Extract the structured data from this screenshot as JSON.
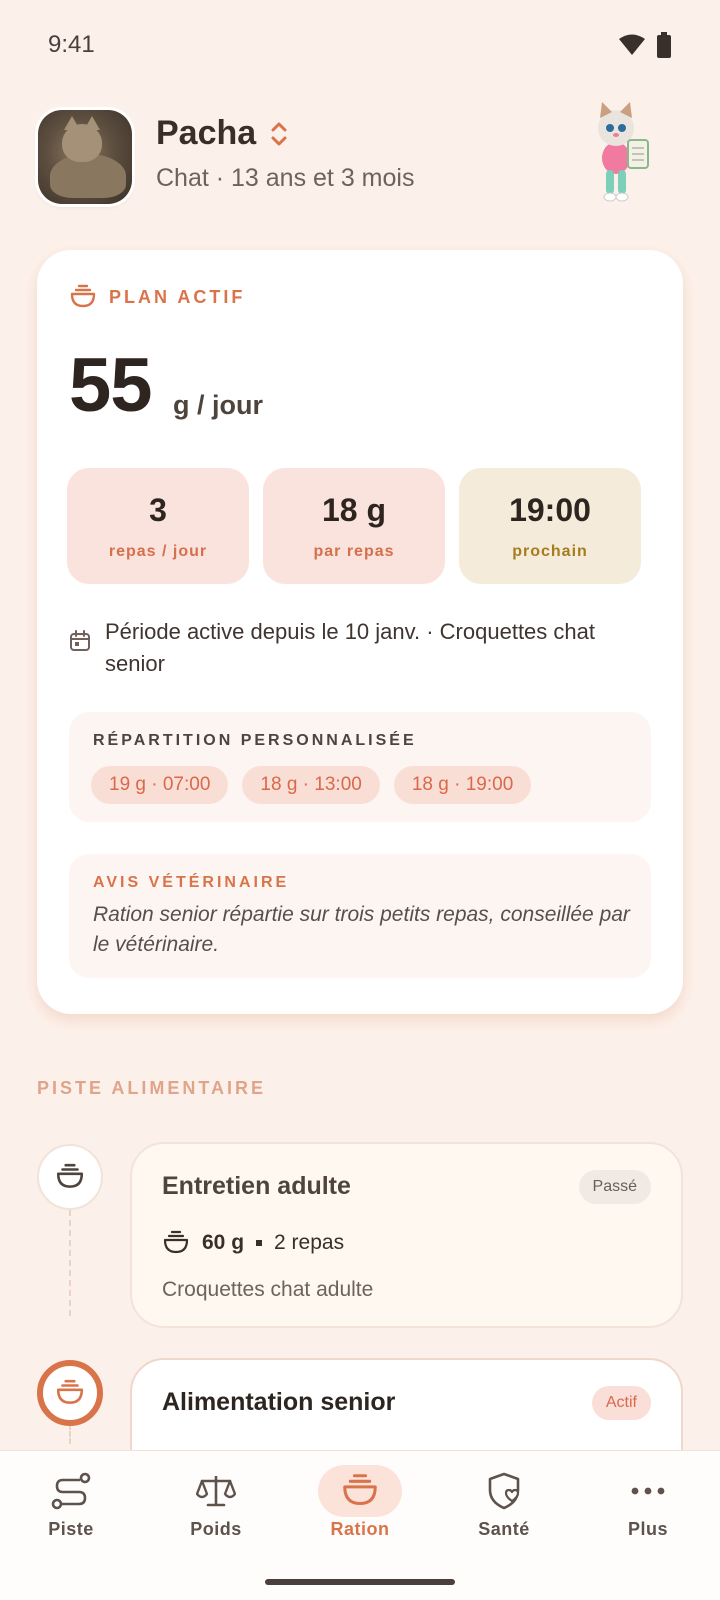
{
  "status_bar": {
    "time": "9:41"
  },
  "pet": {
    "name": "Pacha",
    "subtitle": "Chat · 13 ans et 3 mois"
  },
  "plan": {
    "label": "PLAN ACTIF",
    "daily_amount": "55",
    "daily_unit": "g / jour",
    "stats": [
      {
        "value": "3",
        "label": "repas / jour"
      },
      {
        "value": "18 g",
        "label": "par repas"
      },
      {
        "value": "19:00",
        "label": "prochain"
      }
    ],
    "period": "Période active depuis le 10 janv. · Croquettes chat senior",
    "repartition": {
      "title": "RÉPARTITION PERSONNALISÉE",
      "chips": [
        "19 g · 07:00",
        "18 g · 13:00",
        "18 g · 19:00"
      ]
    },
    "vet": {
      "title": "AVIS VÉTÉRINAIRE",
      "text": "Ration senior répartie sur trois petits repas, conseillée par le vétérinaire."
    }
  },
  "timeline": {
    "title": "PISTE ALIMENTAIRE",
    "items": [
      {
        "title": "Entretien adulte",
        "badge": "Passé",
        "amount": "60 g",
        "meals": "2 repas",
        "food": "Croquettes chat adulte"
      },
      {
        "title": "Alimentation senior",
        "badge": "Actif"
      }
    ]
  },
  "nav": {
    "items": [
      {
        "label": "Piste",
        "icon": "route-icon"
      },
      {
        "label": "Poids",
        "icon": "scale-icon"
      },
      {
        "label": "Ration",
        "icon": "bowl-icon"
      },
      {
        "label": "Santé",
        "icon": "shield-heart-icon"
      },
      {
        "label": "Plus",
        "icon": "more-icon"
      }
    ],
    "active": "Ration"
  },
  "colors": {
    "background": "#FCF1EA",
    "accent": "#D9744A",
    "card": "#FFFFFF",
    "stat_pink": "#F9E3DC",
    "stat_gold": "#F4EBDA"
  }
}
